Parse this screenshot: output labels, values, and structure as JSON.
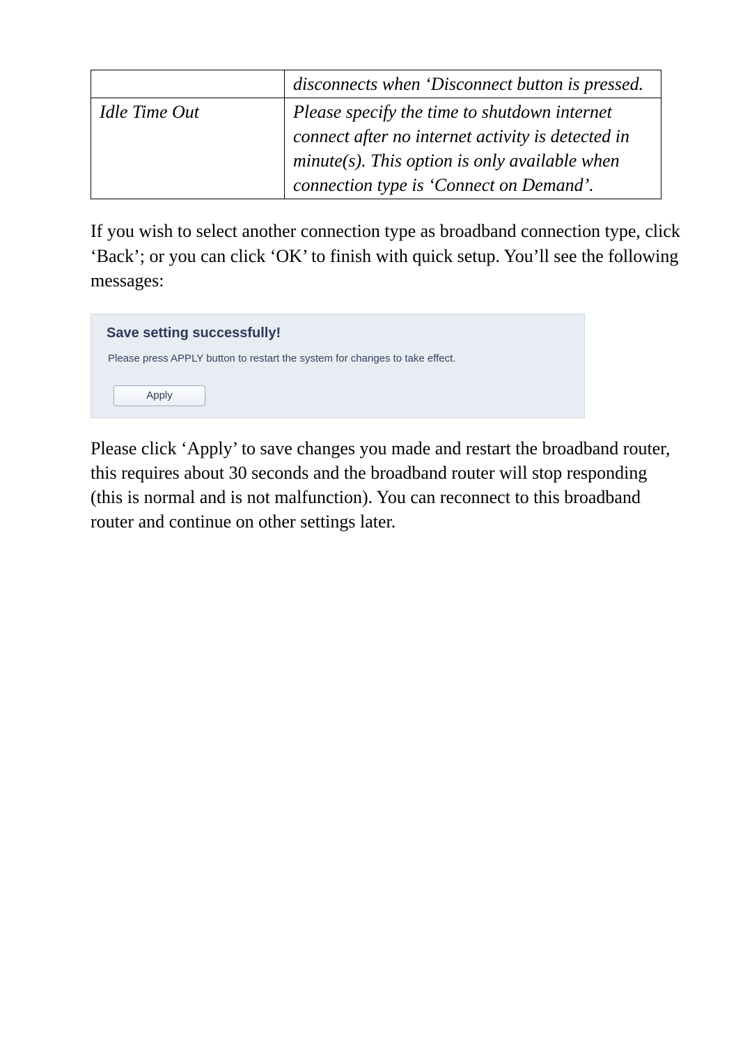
{
  "table": {
    "row1": {
      "left": "",
      "right": "disconnects when ‘Disconnect button is pressed."
    },
    "row2": {
      "left": "Idle Time Out",
      "right": "Please specify the time to shutdown internet connect after no internet activity is detected in minute(s). This option is only available when connection type is ‘Connect on Demand’."
    }
  },
  "paragraph1": "If you wish to select another connection type as broadband connection type, click ‘Back’; or you can click ‘OK’ to finish with quick setup. You’ll see the following messages:",
  "panel": {
    "title": "Save setting successfully!",
    "message": "Please press APPLY button to restart the system for changes to take effect.",
    "button": "Apply"
  },
  "paragraph2": "Please click ‘Apply’ to save changes you made and restart the broadband router, this requires about 30 seconds and the broadband router will stop responding (this is normal and is not malfunction). You can reconnect to this broadband router and continue on other settings later."
}
